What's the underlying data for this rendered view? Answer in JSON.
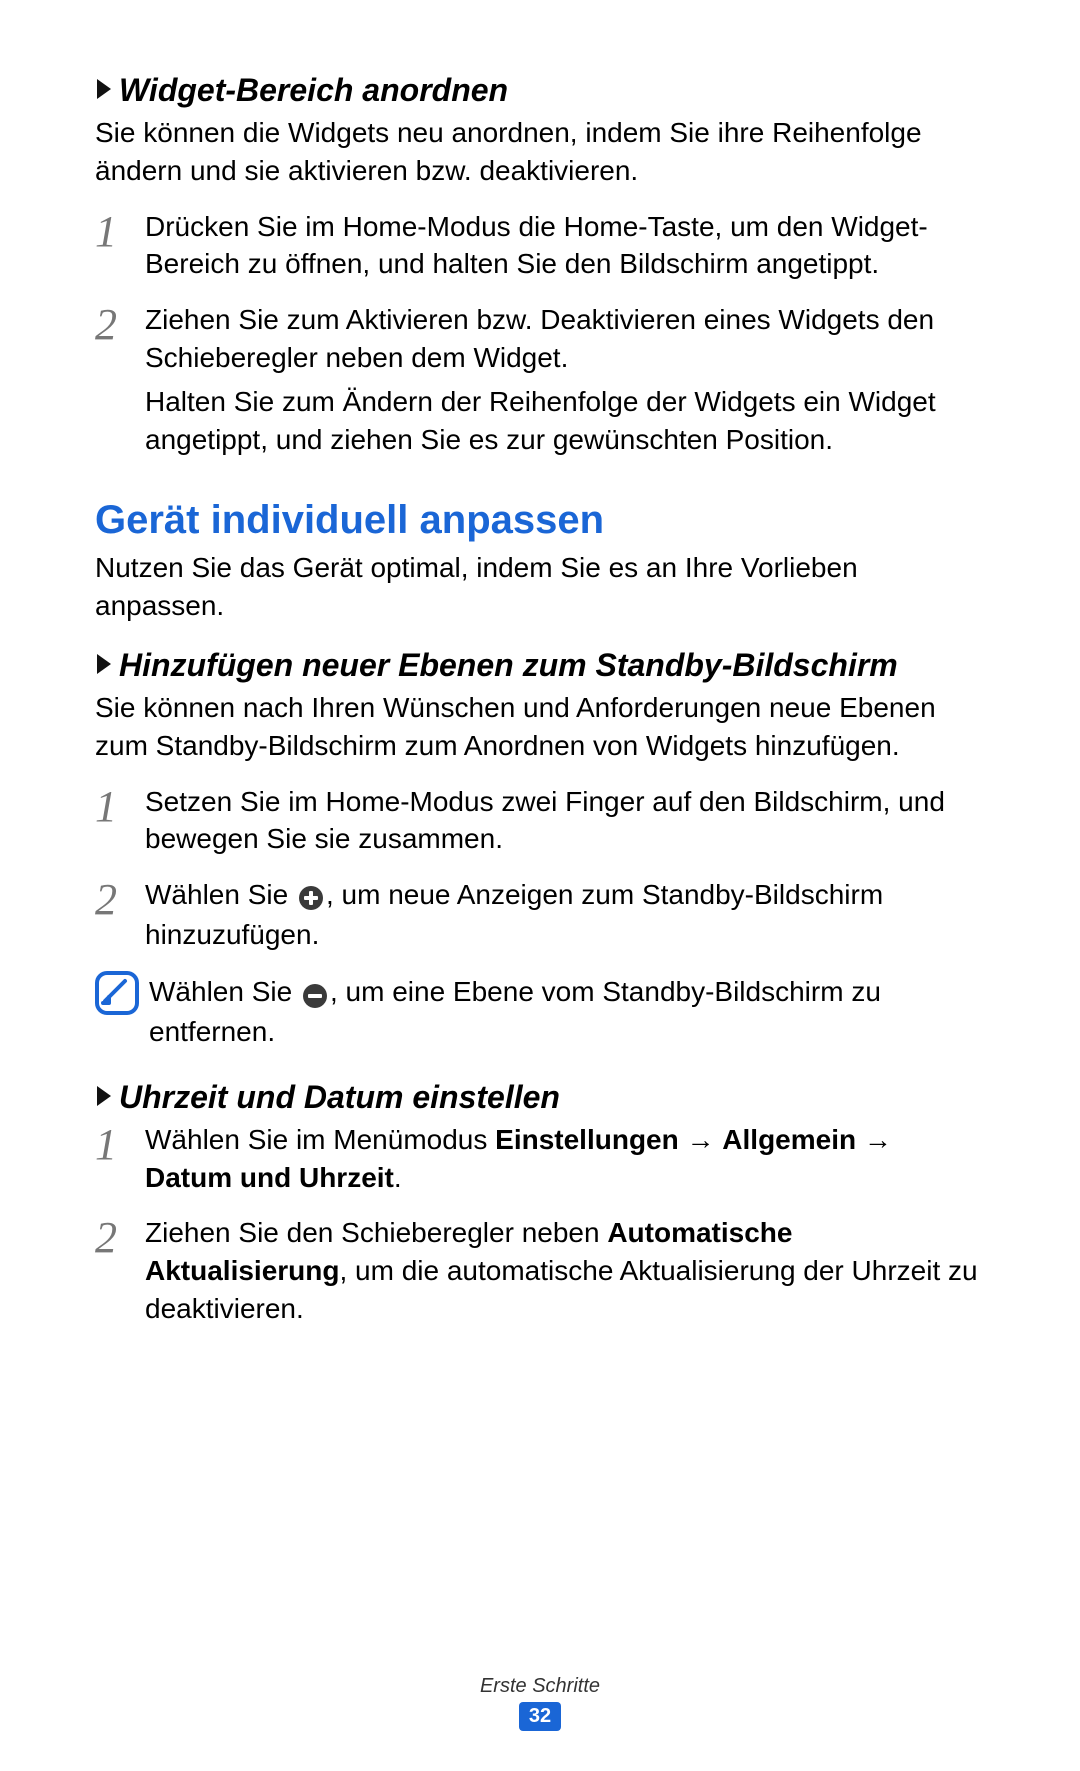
{
  "s1": {
    "title": "Widget-Bereich anordnen",
    "intro": "Sie können die Widgets neu anordnen, indem Sie ihre Reihenfolge ändern und sie aktivieren bzw. deaktivieren.",
    "step1_num": "1",
    "step1": "Drücken Sie im Home-Modus die Home-Taste, um den Widget-Bereich zu öffnen, und halten Sie den Bildschirm angetippt.",
    "step2_num": "2",
    "step2a": "Ziehen Sie zum Aktivieren bzw. Deaktivieren eines Widgets den Schieberegler neben dem Widget.",
    "step2b": "Halten Sie zum Ändern der Reihenfolge der Widgets ein Widget angetippt, und ziehen Sie es zur gewünschten Position."
  },
  "s2": {
    "title": "Gerät individuell anpassen",
    "intro": "Nutzen Sie das Gerät optimal, indem Sie es an Ihre Vorlieben anpassen."
  },
  "s3": {
    "title": "Hinzufügen neuer Ebenen zum Standby-Bildschirm",
    "intro": "Sie können nach Ihren Wünschen und Anforderungen neue Ebenen zum Standby-Bildschirm zum Anordnen von Widgets hinzufügen.",
    "step1_num": "1",
    "step1": "Setzen Sie im Home-Modus zwei Finger auf den Bildschirm, und bewegen Sie sie zusammen.",
    "step2_num": "2",
    "step2_pre": "Wählen Sie ",
    "step2_post": ", um neue Anzeigen zum Standby-Bildschirm hinzuzufügen.",
    "note_pre": "Wählen Sie ",
    "note_post": ", um eine Ebene vom Standby-Bildschirm zu entfernen."
  },
  "s4": {
    "title": "Uhrzeit und Datum einstellen",
    "step1_num": "1",
    "step1_pre": "Wählen Sie im Menümodus ",
    "step1_b1": "Einstellungen",
    "step1_arrow": " → ",
    "step1_b2": "Allgemein",
    "step1_b3": "Datum und Uhrzeit",
    "step1_dot": ".",
    "step2_num": "2",
    "step2_pre": "Ziehen Sie den Schieberegler neben ",
    "step2_b": "Automatische Aktualisierung",
    "step2_post": ", um die automatische Aktualisierung der Uhrzeit zu deaktivieren."
  },
  "footer": {
    "text": "Erste Schritte",
    "page": "32"
  }
}
